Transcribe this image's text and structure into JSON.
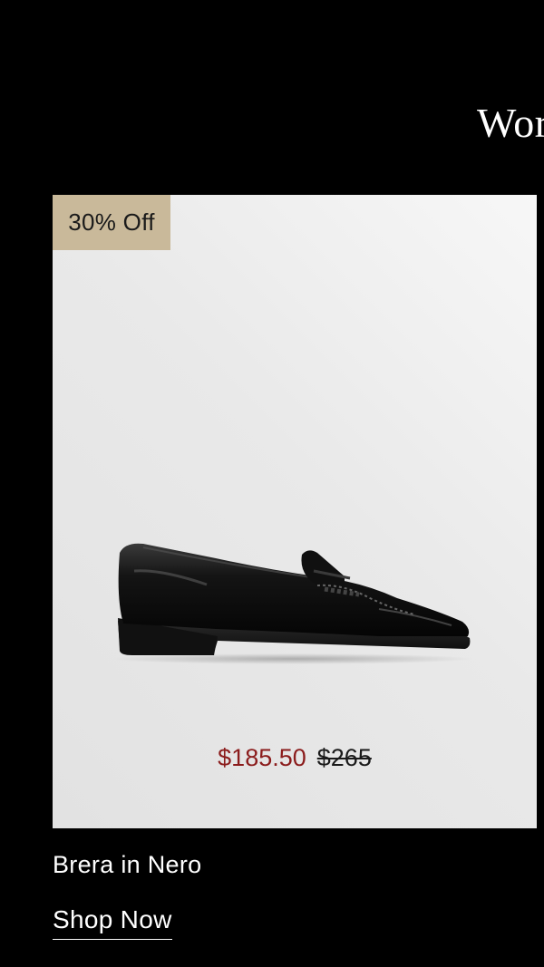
{
  "section": {
    "heading": "Wor"
  },
  "product": {
    "badge": "30% Off",
    "image_icon": "loafer-shoe-image",
    "sale_price": "$185.50",
    "original_price": "$265",
    "name": "Brera in Nero",
    "cta_label": "Shop Now"
  },
  "colors": {
    "background": "#000000",
    "badge_bg": "#c9b99a",
    "sale_price": "#8b1c1c",
    "card_bg": "#e6e6e6"
  }
}
